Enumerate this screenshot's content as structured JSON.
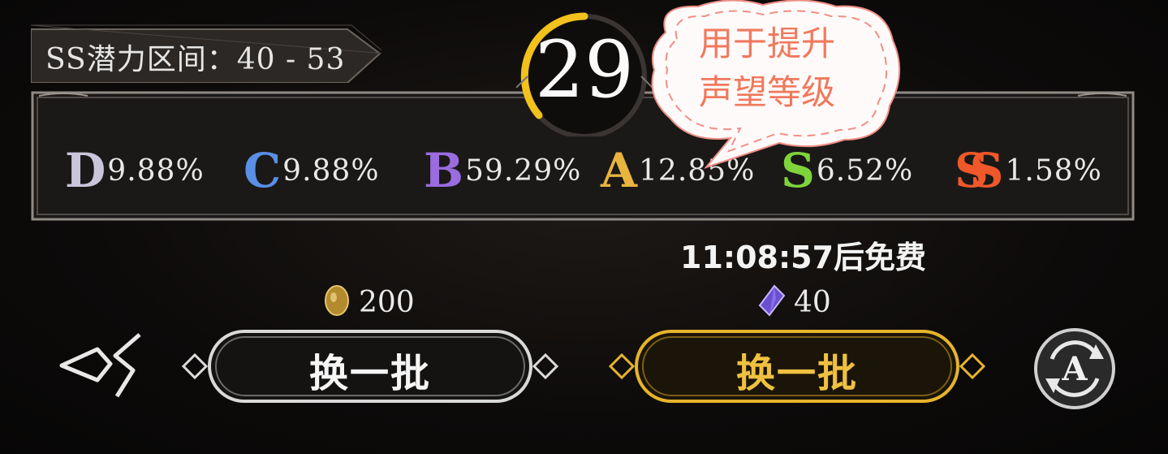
{
  "range_label": "SS潜力区间：40 - 53",
  "level": "29",
  "tooltip": {
    "line1": "用于提升",
    "line2": "声望等级"
  },
  "grades": [
    {
      "letter": "D",
      "pct": "9.88%",
      "color": "#c9c6dc"
    },
    {
      "letter": "C",
      "pct": "9.88%",
      "color": "#5a8fe6"
    },
    {
      "letter": "B",
      "pct": "59.29%",
      "color": "#9a6ce0"
    },
    {
      "letter": "A",
      "pct": "12.85%",
      "color": "#e9b43e"
    },
    {
      "letter": "S",
      "pct": "6.52%",
      "color": "#7fd43c"
    },
    {
      "letter": "SS",
      "pct": "1.58%",
      "color": "#f0582a"
    }
  ],
  "free_timer": "11:08:57后免费",
  "cost_left": {
    "icon": "gold-coin-icon",
    "amount": "200"
  },
  "cost_right": {
    "icon": "purple-crystal-icon",
    "amount": "40"
  },
  "button_left": {
    "label": "换一批"
  },
  "button_right": {
    "label": "换一批"
  },
  "colors": {
    "gold": "#f0c040",
    "tooltip_text": "#f0795d",
    "level_arc": "#f2c11c"
  }
}
